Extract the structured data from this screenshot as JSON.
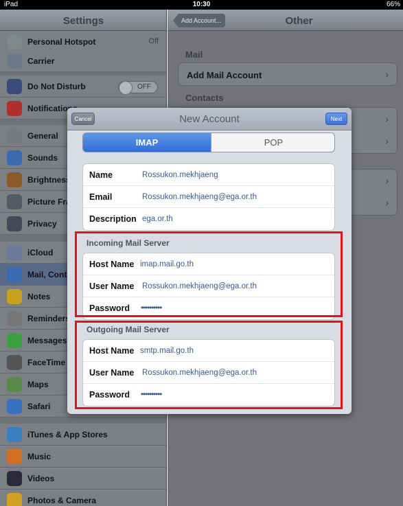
{
  "status": {
    "carrier": "iPad",
    "time": "10:30",
    "battery": "66%"
  },
  "settings": {
    "title": "Settings",
    "items": [
      {
        "label": "Personal Hotspot",
        "value": "Off",
        "color": "#7e8a8a"
      },
      {
        "label": "Carrier",
        "color": "#6a7a8a"
      },
      {
        "label": "Do Not Disturb",
        "toggle": "OFF",
        "color": "#3a4a7a"
      },
      {
        "label": "Notifications",
        "color": "#b03030"
      },
      {
        "label": "General",
        "color": "#777b80"
      },
      {
        "label": "Sounds",
        "color": "#3a6ab0"
      },
      {
        "label": "Brightness & Wallpaper",
        "color": "#8a5a2a"
      },
      {
        "label": "Picture Frame",
        "color": "#555a60"
      },
      {
        "label": "Privacy",
        "color": "#444a55"
      },
      {
        "label": "iCloud",
        "color": "#6a7a9a"
      },
      {
        "label": "Mail, Contacts, Calendars",
        "color": "#3a6ab0"
      },
      {
        "label": "Notes",
        "color": "#c8a020"
      },
      {
        "label": "Reminders",
        "color": "#777"
      },
      {
        "label": "Messages",
        "color": "#3aa040"
      },
      {
        "label": "FaceTime",
        "color": "#555"
      },
      {
        "label": "Maps",
        "color": "#5a8a4a"
      },
      {
        "label": "Safari",
        "color": "#3a70c0"
      },
      {
        "label": "iTunes & App Stores",
        "color": "#3a80c0"
      },
      {
        "label": "Music",
        "color": "#d07020"
      },
      {
        "label": "Videos",
        "color": "#2a2a3a"
      },
      {
        "label": "Photos & Camera",
        "color": "#d0a020"
      }
    ]
  },
  "other": {
    "back_label": "Add Account...",
    "title": "Other",
    "mail_header": "Mail",
    "add_mail": "Add Mail Account",
    "contacts_header": "Contacts"
  },
  "modal": {
    "cancel": "Cancel",
    "title": "New Account",
    "next": "Next",
    "seg_imap": "IMAP",
    "seg_pop": "POP",
    "account": {
      "name_label": "Name",
      "name_value": "Rossukon.mekhjaeng",
      "email_label": "Email",
      "email_value": "Rossukon.mekhjaeng@ega.or.th",
      "desc_label": "Description",
      "desc_value": "ega.or.th"
    },
    "incoming": {
      "title": "Incoming Mail Server",
      "host_label": "Host Name",
      "host_value": "imap.mail.go.th",
      "user_label": "User Name",
      "user_value": "Rossukon.mekhjaeng@ega.or.th",
      "pass_label": "Password",
      "pass_value": "••••••••••"
    },
    "outgoing": {
      "title": "Outgoing Mail Server",
      "host_label": "Host Name",
      "host_value": "smtp.mail.go.th",
      "user_label": "User Name",
      "user_value": "Rossukon.mekhjaeng@ega.or.th",
      "pass_label": "Password",
      "pass_value": "••••••••••"
    }
  }
}
